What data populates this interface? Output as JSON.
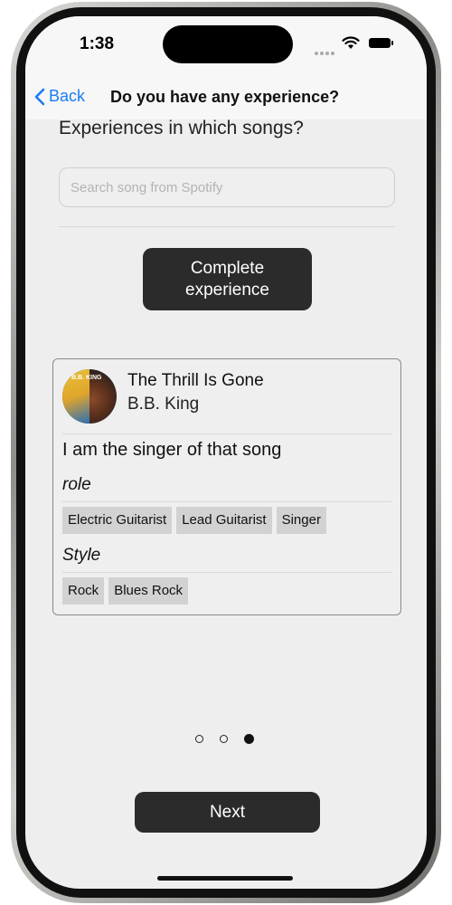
{
  "status_bar": {
    "time": "1:38"
  },
  "nav": {
    "back_label": "Back",
    "title": "Do you have any experience?"
  },
  "main": {
    "question": "Experiences in which songs?",
    "search": {
      "placeholder": "Search song from Spotify",
      "value": ""
    },
    "complete_button_label": "Complete experience"
  },
  "experience_card": {
    "album_art_text": "B.B. KING",
    "song_title": "The Thrill Is Gone",
    "artist": "B.B. King",
    "statement": "I am the singer of that song",
    "role_label": "role",
    "roles": [
      "Electric Guitarist",
      "Lead Guitarist",
      "Singer"
    ],
    "style_label": "Style",
    "styles": [
      "Rock",
      "Blues Rock"
    ]
  },
  "pagination": {
    "total": 3,
    "current": 3
  },
  "footer": {
    "next_label": "Next"
  },
  "colors": {
    "accent": "#1a7cf0",
    "button_bg": "#2b2b2b",
    "tag_bg": "#d2d2d2",
    "screen_bg": "#eeeeee"
  }
}
